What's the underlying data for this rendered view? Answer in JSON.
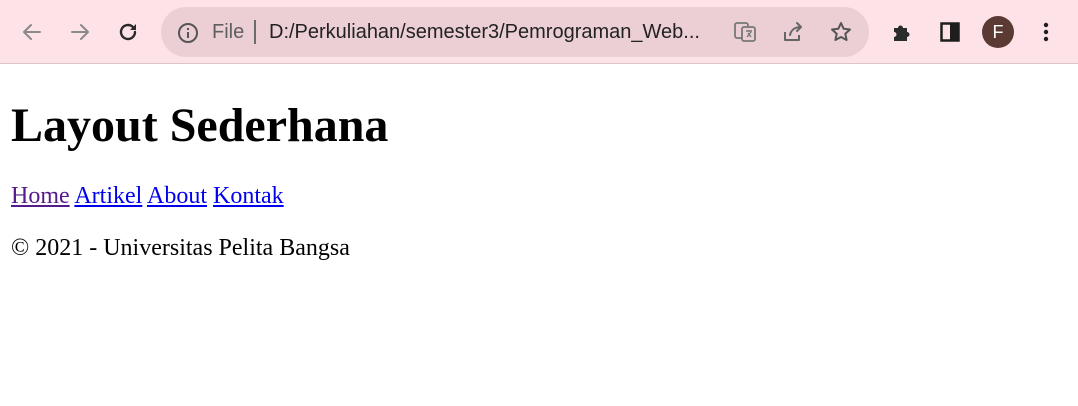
{
  "browser": {
    "omnibox": {
      "scheme_label": "File",
      "url": "D:/Perkuliahan/semester3/Pemrograman_Web..."
    },
    "profile_initial": "F"
  },
  "page": {
    "title": "Layout Sederhana",
    "nav": [
      {
        "label": "Home",
        "visited": true
      },
      {
        "label": "Artikel"
      },
      {
        "label": "About"
      },
      {
        "label": "Kontak"
      }
    ],
    "footer": "© 2021 - Universitas Pelita Bangsa"
  }
}
